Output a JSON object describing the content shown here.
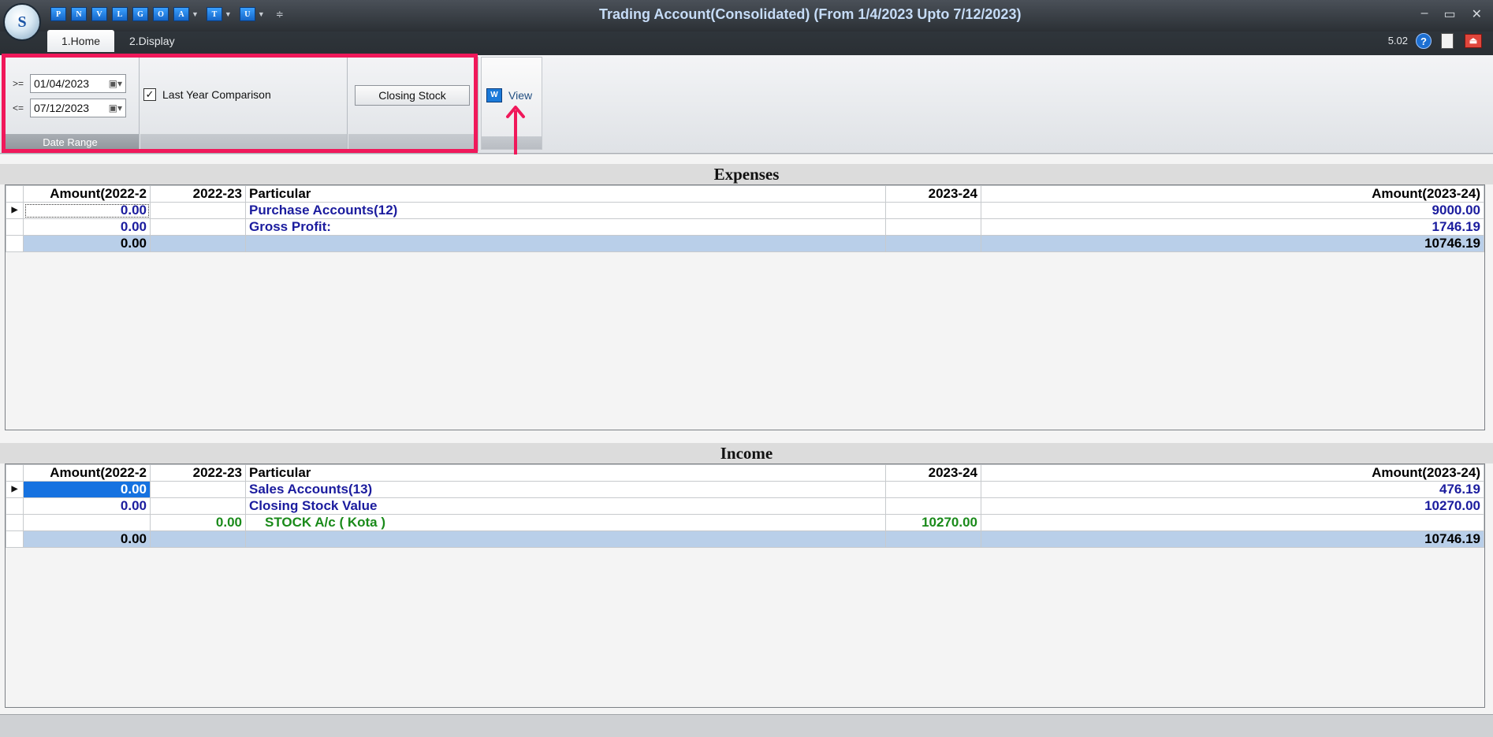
{
  "app": {
    "title": "Trading Account(Consolidated) (From 1/4/2023 Upto 7/12/2023)",
    "version": "5.02",
    "logo_text": "S",
    "quick_access": [
      {
        "label": "P",
        "has_dropdown": false
      },
      {
        "label": "N",
        "has_dropdown": false
      },
      {
        "label": "V",
        "has_dropdown": false
      },
      {
        "label": "L",
        "has_dropdown": false
      },
      {
        "label": "G",
        "has_dropdown": false
      },
      {
        "label": "O",
        "has_dropdown": false
      },
      {
        "label": "A",
        "has_dropdown": true
      },
      {
        "label": "T",
        "has_dropdown": true
      },
      {
        "label": "U",
        "has_dropdown": true
      }
    ],
    "window_controls": [
      "–",
      "▭",
      "✕"
    ]
  },
  "ribbon": {
    "tabs": [
      "1.Home",
      "2.Display"
    ],
    "date_range": {
      "caption": "Date Range",
      "from_op": ">=",
      "from_value": "01/04/2023",
      "to_op": "<=",
      "to_value": "07/12/2023"
    },
    "last_year_comparison": {
      "label": "Last Year Comparison",
      "checked": true,
      "check_glyph": "✓"
    },
    "closing_stock_label": "Closing Stock",
    "view_label": "View"
  },
  "expenses": {
    "title": "Expenses",
    "columns": [
      "Amount(2022-2",
      "2022-23",
      "Particular",
      "2023-24",
      "Amount(2023-24)"
    ],
    "rows": [
      {
        "amt_prev": "0.00",
        "prev": "",
        "particular": "Purchase Accounts(12)",
        "cur": "",
        "amt_cur": "9000.00"
      },
      {
        "amt_prev": "0.00",
        "prev": "",
        "particular": "Gross Profit:",
        "cur": "",
        "amt_cur": "1746.19"
      }
    ],
    "total": {
      "amt_prev": "0.00",
      "amt_cur": "10746.19"
    }
  },
  "income": {
    "title": "Income",
    "columns": [
      "Amount(2022-2",
      "2022-23",
      "Particular",
      "2023-24",
      "Amount(2023-24)"
    ],
    "rows": [
      {
        "amt_prev": "0.00",
        "prev": "",
        "particular": "Sales Accounts(13)",
        "cur": "",
        "amt_cur": "476.19"
      },
      {
        "amt_prev": "0.00",
        "prev": "",
        "particular": "Closing Stock Value",
        "cur": "",
        "amt_cur": "10270.00"
      },
      {
        "amt_prev": "",
        "prev": "0.00",
        "particular": "STOCK A/c ( Kota )",
        "cur": "10270.00",
        "amt_cur": ""
      }
    ],
    "total": {
      "amt_prev": "0.00",
      "amt_cur": "10746.19"
    }
  },
  "colors": {
    "highlight": "#f0185a",
    "total_row": "#b9cfe9",
    "blue_text": "#1b1c9e",
    "green_text": "#1a8a1a",
    "selection": "#1672e0"
  }
}
